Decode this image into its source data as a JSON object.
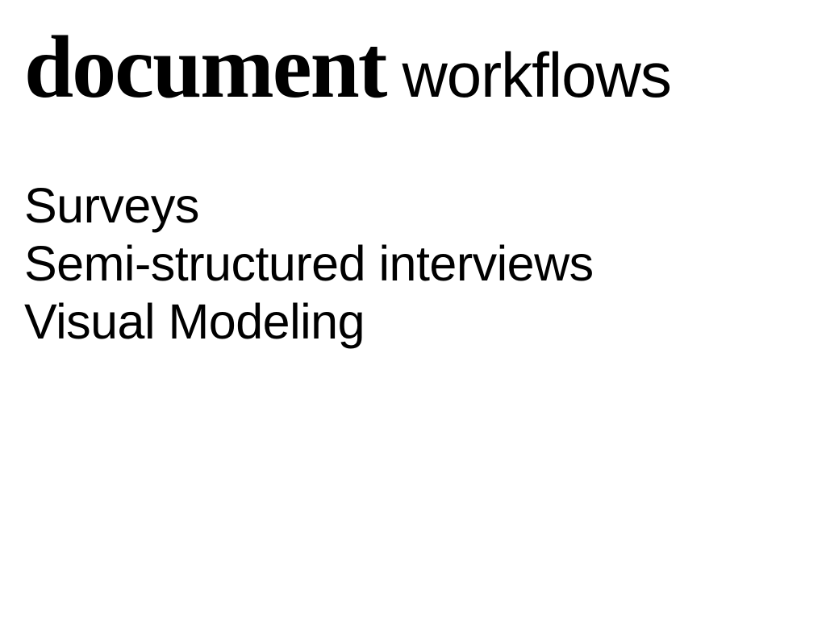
{
  "heading": {
    "bold": "document",
    "light": "workflows"
  },
  "items": [
    "Surveys",
    "Semi-structured interviews",
    "Visual Modeling"
  ]
}
